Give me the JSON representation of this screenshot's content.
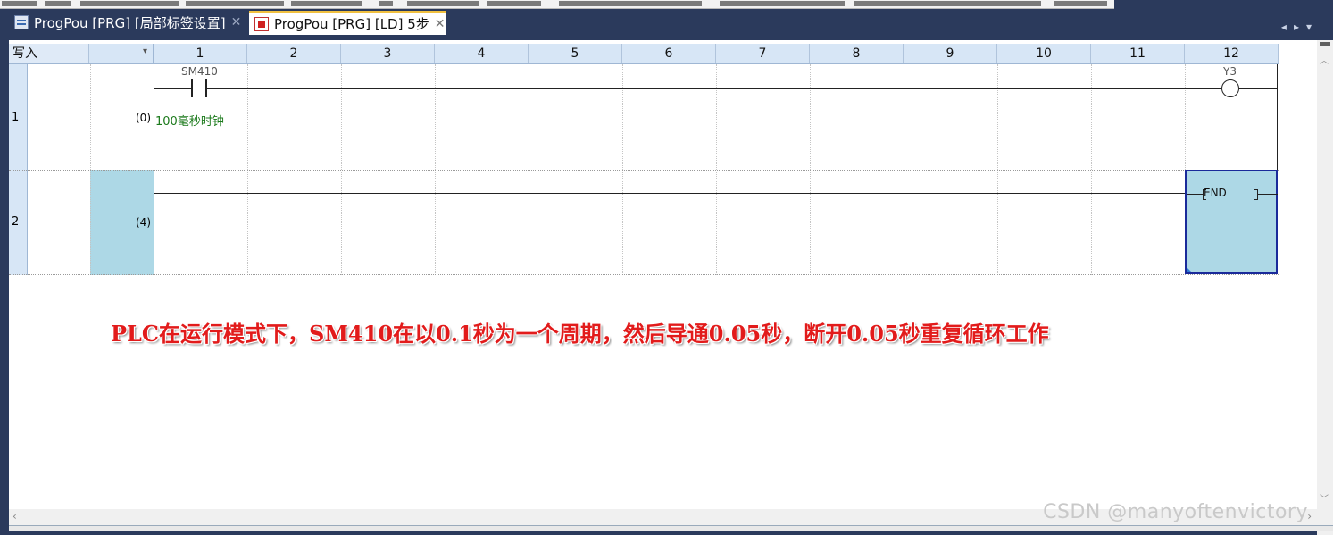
{
  "tabs": [
    {
      "label": "ProgPou [PRG] [局部标签设置]",
      "active": false,
      "icon": "table-icon"
    },
    {
      "label": "ProgPou [PRG] [LD] 5步",
      "active": true,
      "icon": "ladder-icon"
    }
  ],
  "editor": {
    "mode_label": "写入",
    "columns": [
      "1",
      "2",
      "3",
      "4",
      "5",
      "6",
      "7",
      "8",
      "9",
      "10",
      "11",
      "12"
    ],
    "rows": [
      {
        "number": "1",
        "step": "(0)",
        "contact_device": "SM410",
        "contact_comment": "100毫秒时钟",
        "coil_device": "Y3"
      },
      {
        "number": "2",
        "step": "(4)",
        "instruction": "END"
      }
    ]
  },
  "annotation": "PLC在运行模式下，SM410在以0.1秒为一个周期，然后导通0.05秒，断开0.05秒重复循环工作",
  "watermark": "CSDN @manyoftenvictory",
  "colors": {
    "tab_bar": "#2b3a5c",
    "ruler": "#d7e6f6",
    "selection": "#add8e6",
    "annotation": "#e21b1b",
    "comment": "#1c7a1c"
  }
}
